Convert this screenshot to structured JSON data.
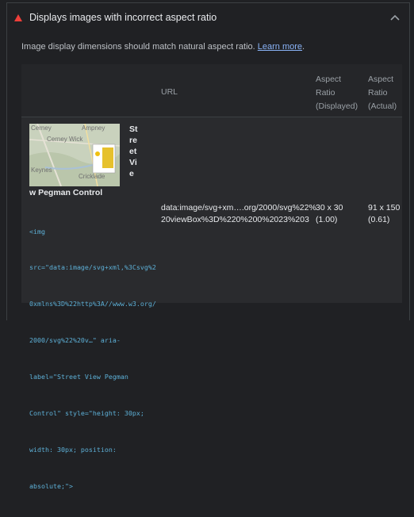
{
  "audit": {
    "title": "Displays images with incorrect aspect ratio",
    "description": "Image display dimensions should match natural aspect ratio.",
    "learn_more": "Learn more",
    "period": ".",
    "status_color": "#ee3f3a",
    "icons": {
      "status": "warning-triangle-icon",
      "toggle": "chevron-up-icon"
    }
  },
  "table": {
    "headers": {
      "url": "URL",
      "displayed": [
        "Aspect",
        "Ratio",
        "(Displayed)"
      ],
      "actual": [
        "Aspect",
        "Ratio",
        "(Actual)"
      ]
    },
    "rows": [
      {
        "node_label_vertical": "Street Vie",
        "node_label_rest": "w Pegman Control",
        "snippet_lines": [
          "<img",
          "src=\"data:image/svg+xml,%3Csvg%2",
          "0xmlns%3D%22http%3A//www.w3.org/",
          "2000/svg%22%20v…\" aria-",
          "label=\"Street View Pegman",
          "Control\" style=\"height: 30px;",
          "width: 30px; position:",
          "absolute;\">"
        ],
        "url_lines": [
          "data:image/svg+xm….org/2000/svg%22%",
          "20viewBox%3D%220%200%2023%203"
        ],
        "displayed": [
          "30 x 30",
          "(1.00)"
        ],
        "actual": [
          "91 x 150",
          "(0.61)"
        ],
        "thumbnail_places": [
          "Cerney",
          "Ampney",
          "Cerney Wick",
          "Keynes",
          "Cricklade"
        ]
      }
    ]
  }
}
